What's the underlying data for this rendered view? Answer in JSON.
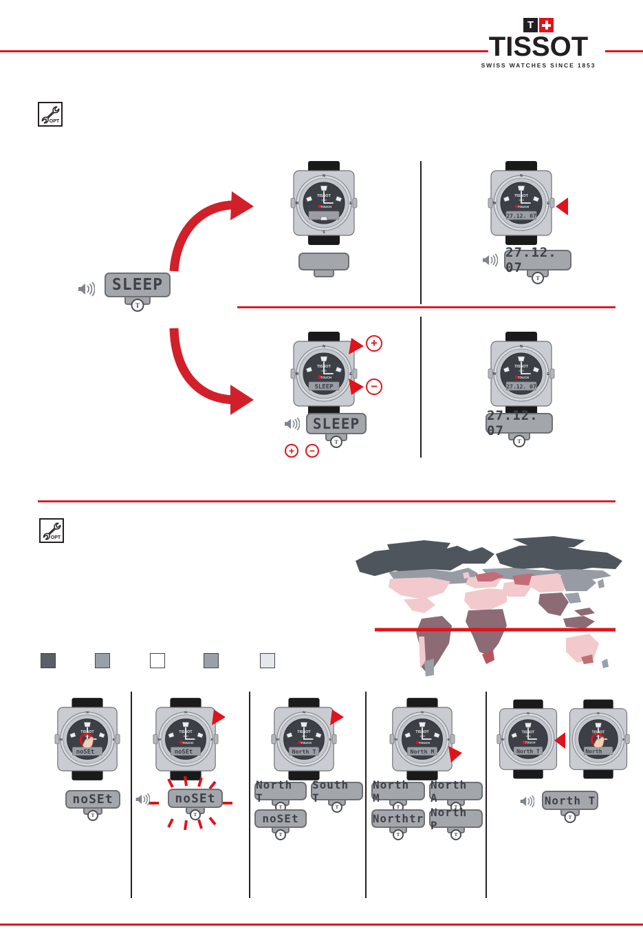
{
  "brand": {
    "letter": "T",
    "wordmark": "TISSOT",
    "tagline": "SWISS WATCHES SINCE 1853",
    "red": "#e1121a",
    "black": "#231f20"
  },
  "icons": {
    "opt_label": "OPT",
    "wrench": "wrench-icon",
    "speaker": "speaker-icon",
    "plus": "+",
    "minus": "−",
    "lcd_t_letter": "T"
  },
  "section_sleep": {
    "name": "sleep-mode-section",
    "opt_badge": "OPT",
    "source_display": "SLEEP",
    "row_top": {
      "name": "sleep-activated-row",
      "watch_display": "",
      "result_display": "",
      "right_watch_display": "27.12. 07",
      "right_display": "27.12. 07"
    },
    "row_bottom": {
      "name": "sleep-deactivate-row",
      "watch_display": "SLEEP",
      "result_display": "SLEEP",
      "buttons": [
        "+",
        "−"
      ],
      "right_watch_display": "27.12. 07",
      "right_display": "27.12. 07"
    }
  },
  "section_timezone": {
    "name": "timezone-section",
    "opt_badge": "OPT",
    "map": {
      "name": "world-timezone-map",
      "equator_color": "#e1121a",
      "zone_colors": [
        "#4f555d",
        "#979ca4",
        "#ffffff",
        "#9aa0a8",
        "#e3e6ea"
      ]
    },
    "legend": [
      {
        "label": "",
        "color": "#5a6069"
      },
      {
        "label": "",
        "color": "#9aa0a8"
      },
      {
        "label": "",
        "color": "#ffffff"
      },
      {
        "label": "",
        "color": "#9aa0a8"
      },
      {
        "label": "",
        "color": "#e4e7eb"
      }
    ],
    "panels": [
      {
        "name": "panel-touch-start",
        "watch_display": "noSEt",
        "displays": [
          "noSEt"
        ],
        "flashing": false,
        "touch": true,
        "arrow": false
      },
      {
        "name": "panel-noset-flashing",
        "watch_display": "noSEt",
        "displays": [
          "noSEt"
        ],
        "flashing": true,
        "touch": false,
        "arrow": true
      },
      {
        "name": "panel-north-south",
        "watch_display": "North T",
        "displays": [
          "North T",
          "South T",
          "noSEt"
        ],
        "flashing": false,
        "touch": false,
        "arrow": true
      },
      {
        "name": "panel-north-variants",
        "watch_display": "North M",
        "displays": [
          "North M",
          "North A",
          "Northtr",
          "North P"
        ],
        "flashing": false,
        "touch": false,
        "arrow": true
      },
      {
        "name": "panel-confirm",
        "watch_display": "North T",
        "watch_display_2": "North t",
        "displays": [
          "North T"
        ],
        "flashing": false,
        "touch": true,
        "arrow": true
      }
    ]
  }
}
